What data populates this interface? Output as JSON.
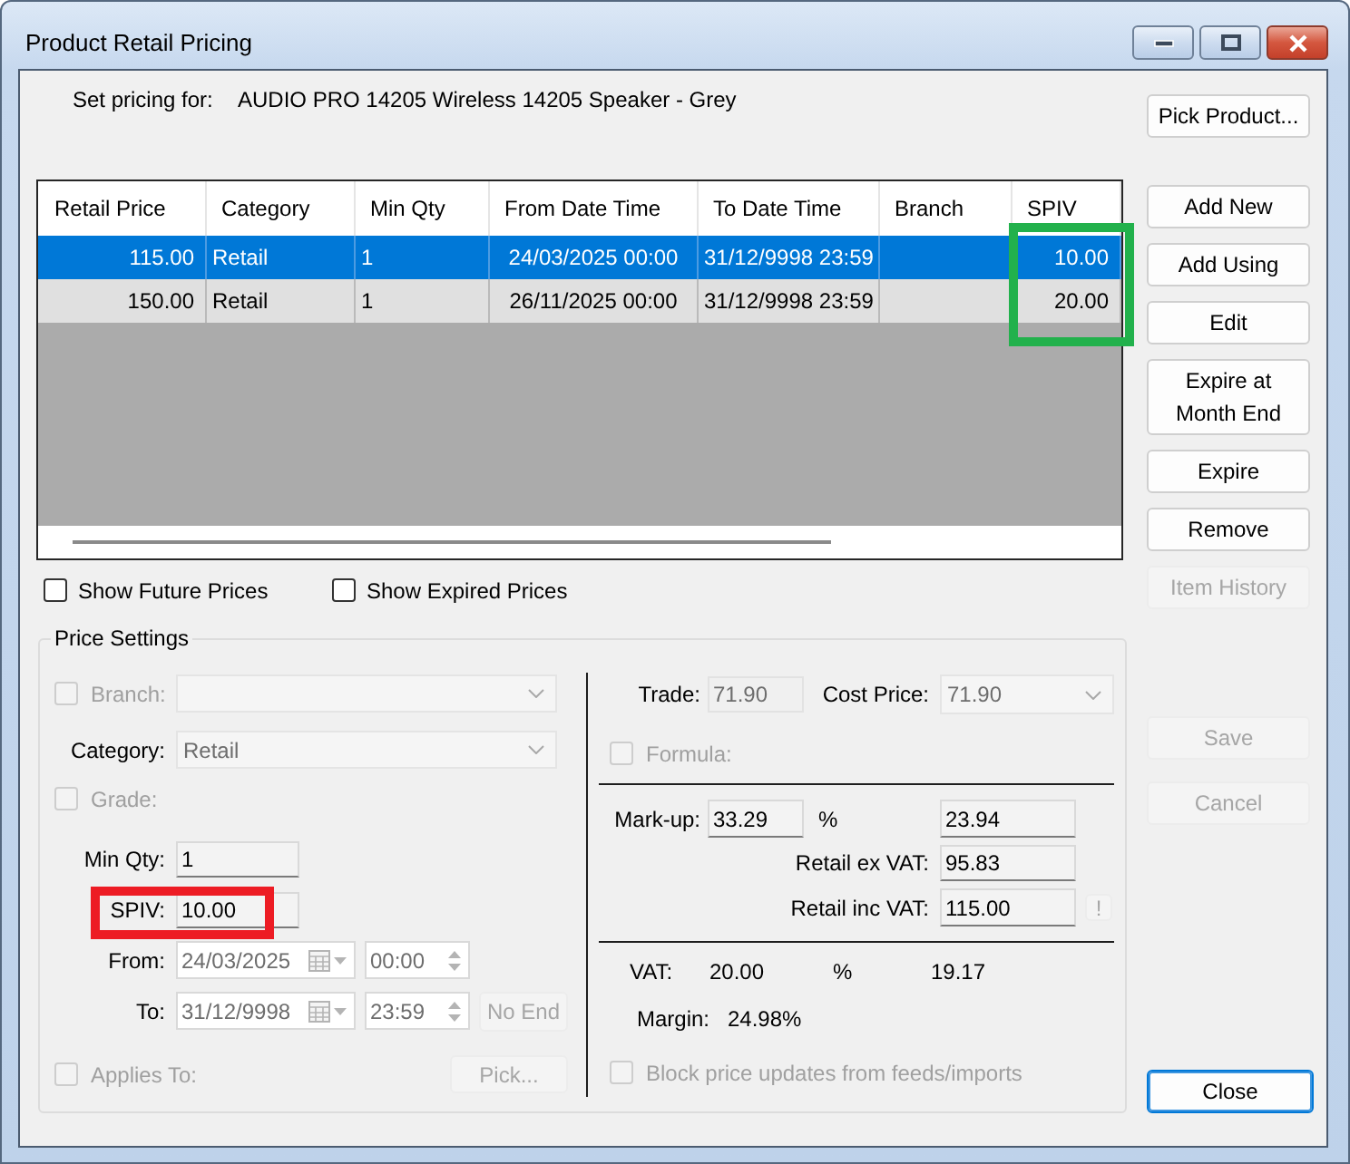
{
  "window": {
    "title": "Product Retail Pricing"
  },
  "product": {
    "label": "Set pricing for:",
    "name": "AUDIO PRO 14205 Wireless 14205 Speaker - Grey",
    "button": {
      "label": "Pick Product...",
      "disabled": false
    }
  },
  "table": {
    "columns": [
      "Retail Price",
      "Category",
      "Min Qty",
      "From Date Time",
      "To Date Time",
      "Branch",
      "SPIV"
    ],
    "rows": [
      {
        "selected": true,
        "retail_price": "115.00",
        "category": "Retail",
        "min_qty": "1",
        "from": "24/03/2025 00:00",
        "to": "31/12/9998 23:59",
        "spiv": "10.00"
      },
      {
        "selected": false,
        "retail_price": "150.00",
        "category": "Retail",
        "min_qty": "1",
        "from": "26/11/2025 00:00",
        "to": "31/12/9998 23:59",
        "spiv": "20.00"
      }
    ]
  },
  "filters": [
    {
      "label": "Show Future Prices",
      "checked": false
    },
    {
      "label": "Show Expired Prices",
      "checked": false
    }
  ],
  "price_settings": {
    "title": "Price Settings",
    "branch": {
      "label": "Branch:",
      "checked": false,
      "disabled": true
    },
    "category": {
      "label": "Category:",
      "value": "Retail",
      "disabled": true
    },
    "grade": {
      "label": "Grade:",
      "checked": false,
      "disabled": true
    },
    "min_qty": {
      "label": "Min Qty:",
      "value": "1"
    },
    "spiv": {
      "label": "SPIV:",
      "value": "10.00"
    },
    "from": {
      "label": "From:",
      "date": "24/03/2025",
      "time": "00:00",
      "disabled": true
    },
    "to": {
      "label": "To:",
      "date": "31/12/9998",
      "time": "23:59",
      "disabled": true,
      "button": {
        "label": "No End",
        "disabled": true
      }
    },
    "applies_to": {
      "label": "Applies To:",
      "checked": false,
      "disabled": true,
      "button": {
        "label": "Pick...",
        "disabled": true
      }
    },
    "trade": {
      "label": "Trade:",
      "value": "71.90",
      "disabled": true
    },
    "cost_price": {
      "label": "Cost Price:",
      "value": "71.90",
      "disabled": true
    },
    "formula": {
      "label": "Formula:",
      "checked": false,
      "disabled": true
    },
    "markup": {
      "label": "Mark-up:",
      "value": "33.29",
      "unit": "%",
      "amount": "23.94"
    },
    "retail_ex_vat": {
      "label": "Retail ex VAT:",
      "value": "95.83"
    },
    "retail_inc_vat": {
      "label": "Retail inc VAT:",
      "value": "115.00",
      "button": {
        "label": "!",
        "disabled": true
      }
    },
    "vat": {
      "label": "VAT:",
      "rate": "20.00",
      "unit": "%",
      "amount": "19.17"
    },
    "margin": {
      "label": "Margin:",
      "value": "24.98%"
    },
    "block_updates": {
      "label": "Block price updates from feeds/imports",
      "checked": false,
      "disabled": true
    }
  },
  "action_buttons": [
    {
      "label": "Add New",
      "disabled": false
    },
    {
      "label": "Add Using",
      "disabled": false
    },
    {
      "label": "Edit",
      "disabled": false
    },
    {
      "label": "Expire at Month End",
      "disabled": false
    },
    {
      "label": "Expire",
      "disabled": false
    },
    {
      "label": "Remove",
      "disabled": false
    },
    {
      "label": "Item History",
      "disabled": true
    }
  ],
  "edit_buttons": [
    {
      "label": "Save",
      "disabled": true
    },
    {
      "label": "Cancel",
      "disabled": true
    }
  ],
  "dialog_buttons": [
    {
      "label": "Close",
      "disabled": false,
      "default": true
    }
  ],
  "annotations": [
    {
      "kind": "column",
      "color": "#22b14c"
    },
    {
      "kind": "field",
      "color": "#ed1c24"
    }
  ]
}
